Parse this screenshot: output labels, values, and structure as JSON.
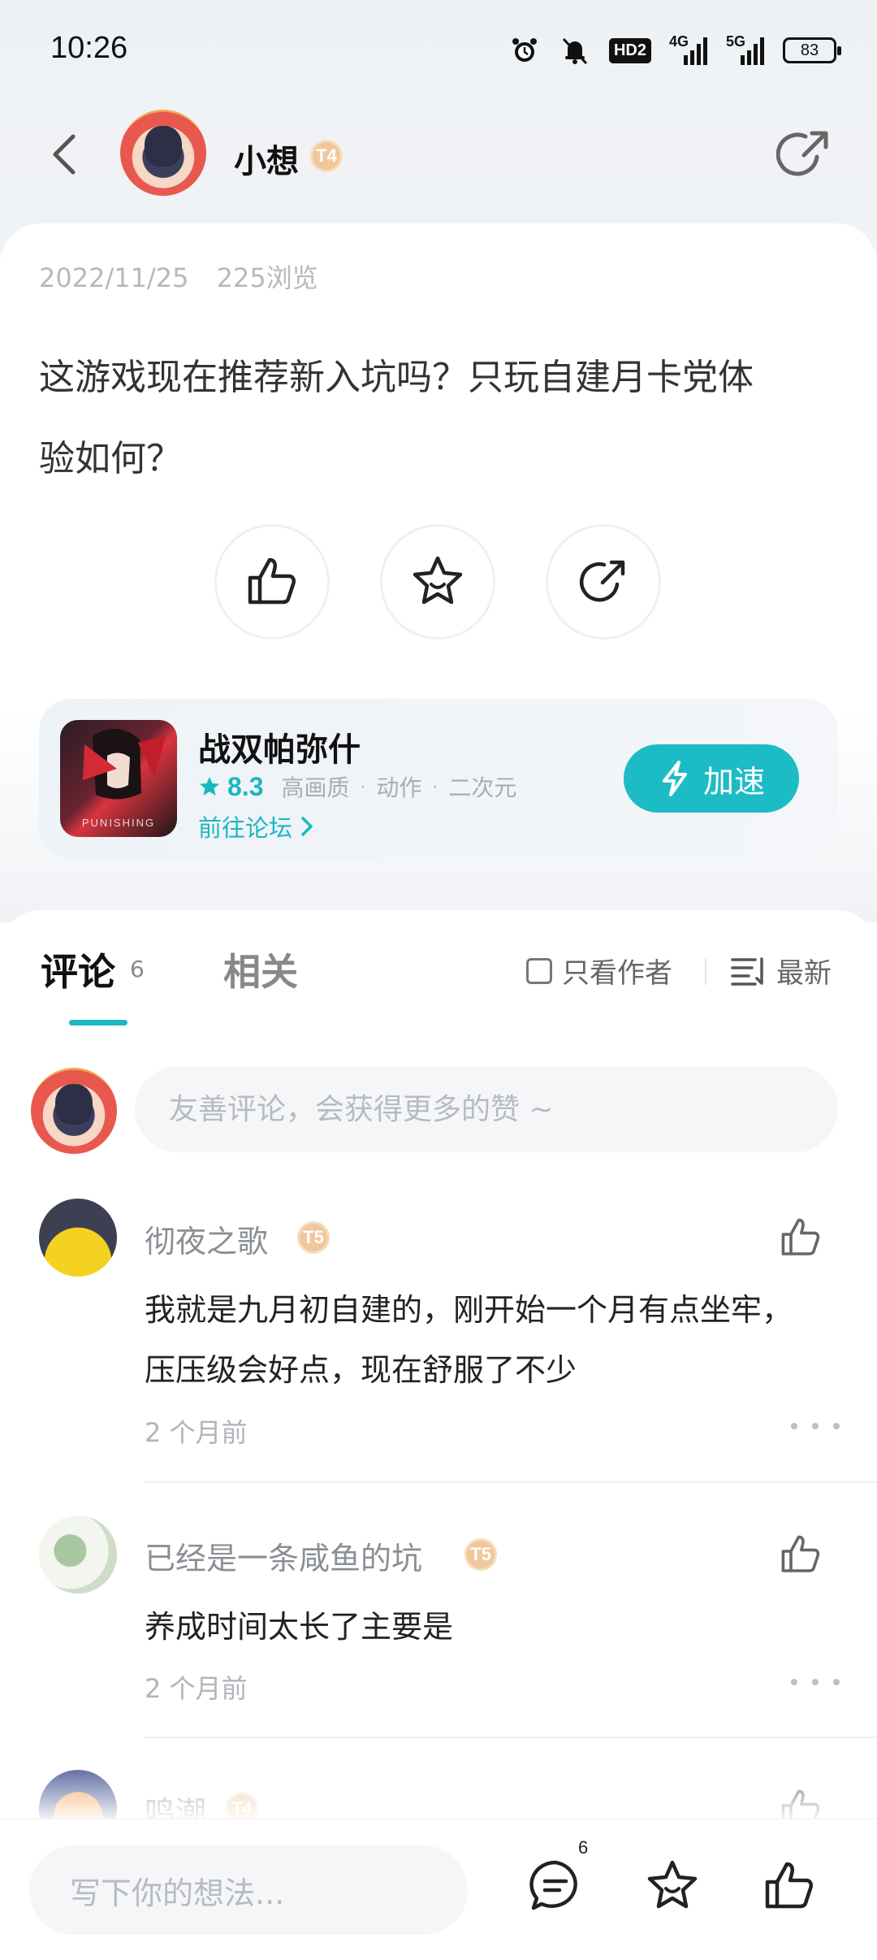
{
  "status_bar": {
    "time": "10:26",
    "network_label": "4G",
    "network_label_2": "5G",
    "hd_label": "HD2",
    "battery": "83"
  },
  "header": {
    "username": "小想",
    "level": "T4"
  },
  "post": {
    "date": "2022/11/25",
    "views": "225浏览",
    "title": "这游戏现在推荐新入坑吗？只玩自建月卡党体验如何？"
  },
  "game": {
    "name": "战双帕弥什",
    "rating": "8.3",
    "tags": [
      "高画质",
      "动作",
      "二次元"
    ],
    "forum_link": "前往论坛",
    "speed_button": "加速",
    "icon_text": "PUNISHING"
  },
  "comments_section": {
    "tab_comments": "评论",
    "comment_count": "6",
    "tab_related": "相关",
    "filter_author": "只看作者",
    "sort_label": "最新",
    "input_placeholder": "友善评论，会获得更多的赞 ~"
  },
  "comments": [
    {
      "name": "彻夜之歌",
      "level": "T5",
      "text": "我就是九月初自建的，刚开始一个月有点坐牢，压压级会好点，现在舒服了不少",
      "time": "2 个月前"
    },
    {
      "name": "已经是一条咸鱼的坑",
      "level": "T5",
      "text": "养成时间太长了主要是",
      "time": "2 个月前"
    },
    {
      "name": "鸣潮",
      "level": "T4",
      "text": "",
      "time": ""
    }
  ],
  "bottom_bar": {
    "placeholder": "写下你的想法...",
    "comment_badge": "6"
  },
  "colors": {
    "accent": "#1bb7c2",
    "badge": "#f0c79d"
  }
}
